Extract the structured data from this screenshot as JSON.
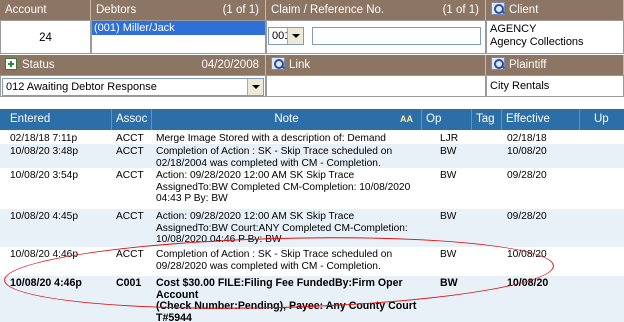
{
  "account": {
    "label": "Account",
    "value": "24"
  },
  "debtors": {
    "label": "Debtors",
    "count": "(1 of 1)",
    "selected": "(001) Miller/Jack"
  },
  "claim": {
    "label": "Claim / Reference No.",
    "count": "(1 of 1)",
    "select_value": "001",
    "input_value": ""
  },
  "client": {
    "label": "Client",
    "line1": "AGENCY",
    "line2": "Agency Collections"
  },
  "status": {
    "label": "Status",
    "date": "04/20/2008",
    "value": "012  Awaiting Debtor Response"
  },
  "link": {
    "label": "Link"
  },
  "plaintiff": {
    "label": "Plaintiff",
    "value": "City Rentals"
  },
  "grid": {
    "columns": {
      "entered": "Entered",
      "assoc": "Assoc",
      "note": "Note",
      "note_icon": "AA",
      "op": "Op",
      "tag": "Tag",
      "effective": "Effective",
      "up": "Up"
    },
    "rows": [
      {
        "entered": "02/18/18 7:11p",
        "assoc": "ACCT",
        "note": [
          "Merge Image Stored with a description of: Demand"
        ],
        "op": "LJR",
        "effective": "02/18/18"
      },
      {
        "entered": "10/08/20 3:48p",
        "assoc": "ACCT",
        "note": [
          "Completion of Action : SK - Skip Trace scheduled on",
          "02/18/2004 was completed with CM - Completion."
        ],
        "op": "BW",
        "effective": "10/08/20"
      },
      {
        "entered": "10/08/20 3:54p",
        "assoc": "ACCT",
        "note": [
          "Action: 09/28/2020  12:00 AM  SK  Skip Trace",
          "AssignedTo:BW Completed CM-Completion: 10/08/2020",
          "04:43 P  By: BW"
        ],
        "op": "BW",
        "effective": "09/28/20"
      },
      {
        "entered": "10/08/20 4:45p",
        "assoc": "ACCT",
        "note": [
          "Action: 09/28/2020  12:00 AM  SK  Skip Trace",
          "AssignedTo:BW Court:ANY Completed CM-Completion:",
          "10/08/2020 04:46 P  By: BW"
        ],
        "op": "BW",
        "effective": "09/28/20"
      },
      {
        "entered": "10/08/20 4:46p",
        "assoc": "ACCT",
        "note": [
          "Completion of Action : SK - Skip Trace scheduled on",
          "09/28/2020 was completed with CM - Completion."
        ],
        "op": "BW",
        "effective": "10/08/20"
      },
      {
        "entered": "10/08/20 4:46p",
        "assoc": "C001",
        "note": [
          "Cost $30.00 FILE:Filing Fee FundedBy:Firm Oper Account",
          "(Check Number:Pending), Payee: Any County Court",
          "T#5944"
        ],
        "op": "BW",
        "effective": "10/08/20"
      }
    ]
  },
  "colors": {
    "header_brown": "#8c7562",
    "grid_header_blue": "#2c6ea8",
    "highlight_red": "#dd1111"
  }
}
